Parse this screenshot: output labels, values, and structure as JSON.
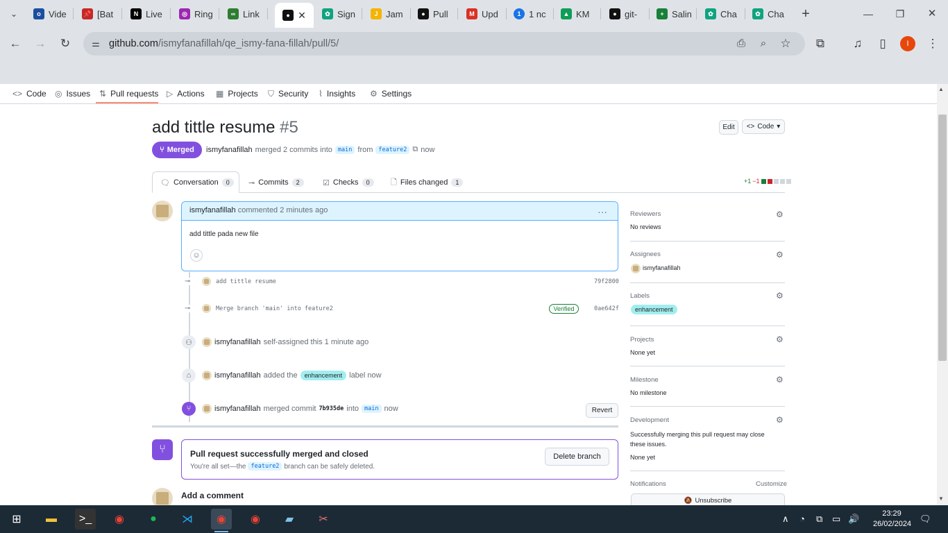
{
  "browser": {
    "tabs": [
      {
        "icon": "onedrive-icon",
        "label": "Vide",
        "color": "#1b4fa0"
      },
      {
        "icon": "pin-icon",
        "label": "[Bat",
        "color": "#c62828"
      },
      {
        "icon": "notion-icon",
        "label": "Live",
        "color": "#000000"
      },
      {
        "icon": "ring-icon",
        "label": "Ring",
        "color": "#9c27b0"
      },
      {
        "icon": "link-icon",
        "label": "Link",
        "color": "#2e7d32"
      },
      {
        "icon": "github-icon",
        "label": "",
        "color": "#111111"
      },
      {
        "icon": "chatgpt-icon",
        "label": "Sign",
        "color": "#10a37f"
      },
      {
        "icon": "jam-icon",
        "label": "Jam",
        "color": "#f4b400"
      },
      {
        "icon": "github-icon",
        "label": "Pull",
        "color": "#111111"
      },
      {
        "icon": "gmail-icon",
        "label": "Upd",
        "color": "#d93025"
      },
      {
        "icon": "one-icon",
        "label": "1 nc",
        "color": "#1a73e8"
      },
      {
        "icon": "drive-icon",
        "label": "KM",
        "color": "#0f9d58"
      },
      {
        "icon": "github-icon",
        "label": "git-",
        "color": "#111111"
      },
      {
        "icon": "sheets-icon",
        "label": "Salin",
        "color": "#188038"
      },
      {
        "icon": "chatgpt-icon",
        "label": "Cha",
        "color": "#10a37f"
      },
      {
        "icon": "chatgpt-icon",
        "label": "Cha",
        "color": "#10a37f"
      }
    ],
    "url_host": "github.com",
    "url_path": "/ismyfanafillah/qe_ismy-fana-fillah/pull/5/",
    "profile_initial": "I"
  },
  "repo_nav": [
    {
      "icon": "code-icon",
      "glyph": "<>",
      "label": "Code"
    },
    {
      "icon": "issues-icon",
      "glyph": "◎",
      "label": "Issues"
    },
    {
      "icon": "pull-request-icon",
      "glyph": "⇅",
      "label": "Pull requests"
    },
    {
      "icon": "actions-icon",
      "glyph": "▷",
      "label": "Actions"
    },
    {
      "icon": "projects-icon",
      "glyph": "▦",
      "label": "Projects"
    },
    {
      "icon": "security-icon",
      "glyph": "⛉",
      "label": "Security"
    },
    {
      "icon": "insights-icon",
      "glyph": "⌇",
      "label": "Insights"
    },
    {
      "icon": "settings-icon",
      "glyph": "⚙",
      "label": "Settings"
    }
  ],
  "pr": {
    "title": "add tittle resume",
    "number": "#5",
    "edit_label": "Edit",
    "code_label": "Code",
    "status": "Merged",
    "author": "ismyfanafillah",
    "merged_text": "merged 2 commits into",
    "base": "main",
    "from": "from",
    "head": "feature2",
    "time": "now"
  },
  "pr_tabs": [
    {
      "label": "Conversation",
      "count": "0",
      "icon": "conversation-icon"
    },
    {
      "label": "Commits",
      "count": "2",
      "icon": "commits-icon"
    },
    {
      "label": "Checks",
      "count": "0",
      "icon": "checks-icon"
    },
    {
      "label": "Files changed",
      "count": "1",
      "icon": "files-icon"
    }
  ],
  "diffstat": {
    "added": "+1",
    "removed": "−1"
  },
  "comment": {
    "author": "ismyfanafillah",
    "action": "commented 2 minutes ago",
    "body": "add tittle pada new file"
  },
  "commits": [
    {
      "message": "add tittle resume",
      "sha": "79f2800",
      "verified": ""
    },
    {
      "message": "Merge branch 'main' into feature2",
      "sha": "0ae642f",
      "verified": "Verified"
    }
  ],
  "events": {
    "assigned": {
      "user": "ismyfanafillah",
      "text": "self-assigned this 1 minute ago"
    },
    "labeled": {
      "user": "ismyfanafillah",
      "pre": "added the",
      "label": "enhancement",
      "post": "label now"
    },
    "merged": {
      "user": "ismyfanafillah",
      "pre": "merged commit",
      "sha": "7b935de",
      "mid": "into",
      "branch": "main",
      "post": "now",
      "revert": "Revert"
    }
  },
  "merge_box": {
    "title": "Pull request successfully merged and closed",
    "pre": "You're all set—the",
    "branch": "feature2",
    "post": "branch can be safely deleted.",
    "delete_label": "Delete branch"
  },
  "add_comment": "Add a comment",
  "sidebar": {
    "reviewers": {
      "title": "Reviewers",
      "value": "No reviews"
    },
    "assignees": {
      "title": "Assignees",
      "value": "ismyfanafillah"
    },
    "labels": {
      "title": "Labels",
      "value": "enhancement"
    },
    "projects": {
      "title": "Projects",
      "value": "None yet"
    },
    "milestone": {
      "title": "Milestone",
      "value": "No milestone"
    },
    "development": {
      "title": "Development",
      "text": "Successfully merging this pull request may close these issues.",
      "value": "None yet"
    },
    "notifications": {
      "title": "Notifications",
      "customize": "Customize",
      "unsubscribe": "Unsubscribe"
    }
  },
  "taskbar": {
    "time": "23:29",
    "date": "26/02/2024"
  },
  "colors": {
    "merged_purple": "#8250df",
    "label_cyan": "#a2eeef",
    "link_blue": "#0969da",
    "underline_orange": "#fd8c73"
  }
}
